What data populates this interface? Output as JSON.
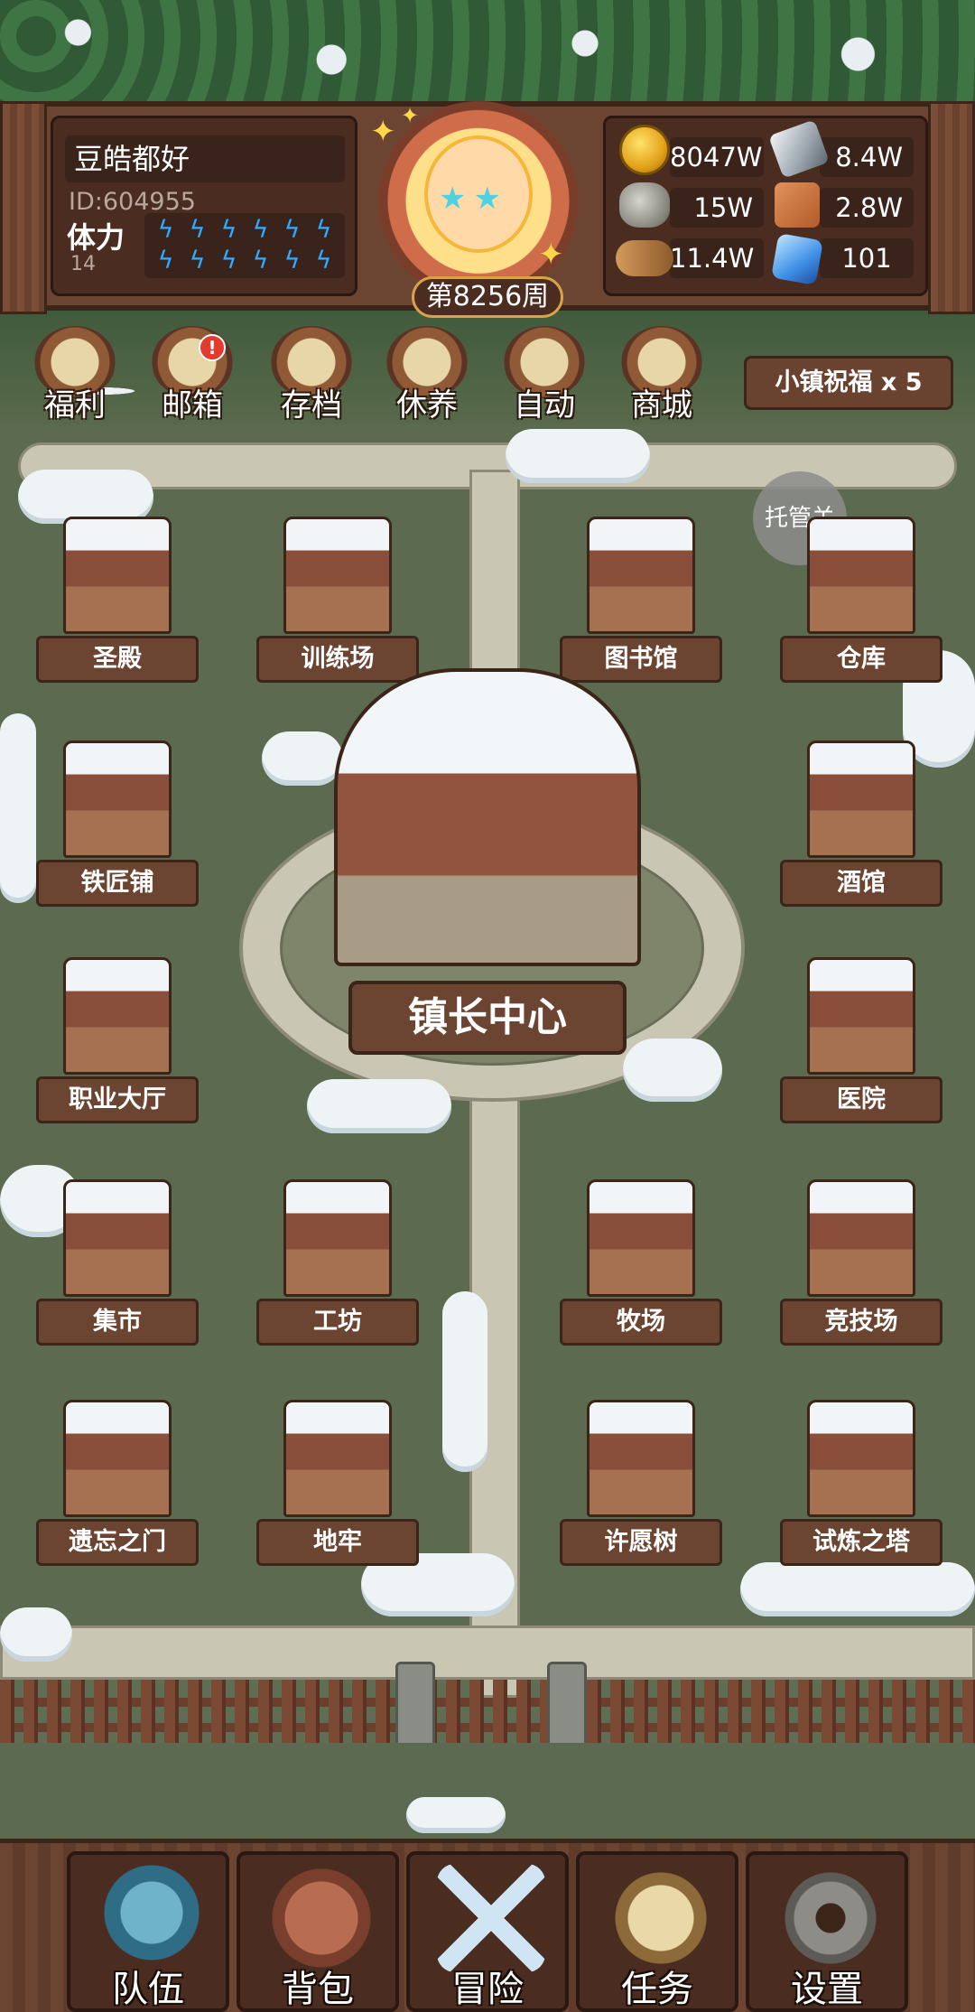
{
  "player": {
    "name": "豆皓都好",
    "id_text": "ID:604955",
    "stamina_label": "体力",
    "stamina_value": "14",
    "week_badge": "第8256周"
  },
  "resources": {
    "gold": "8047W",
    "iron": "8.4W",
    "stone": "15W",
    "leather": "2.8W",
    "wood": "11.4W",
    "crystal": "101"
  },
  "quick_menu": [
    {
      "label": "福利",
      "icon": "wheel-icon"
    },
    {
      "label": "邮箱",
      "icon": "mail-icon",
      "alert": "!"
    },
    {
      "label": "存档",
      "icon": "scroll-icon"
    },
    {
      "label": "休养",
      "icon": "rest-icon"
    },
    {
      "label": "自动",
      "icon": "map-icon"
    },
    {
      "label": "商城",
      "icon": "shop-bag-icon"
    }
  ],
  "blessing": "小镇祝福 x 5",
  "afk_toggle": "托管关",
  "buildings": {
    "temple": "圣殿",
    "training": "训练场",
    "library": "图书馆",
    "warehouse": "仓库",
    "blacksmith": "铁匠铺",
    "tavern": "酒馆",
    "mayor": "镇长中心",
    "guild": "职业大厅",
    "hospital": "医院",
    "market": "集市",
    "workshop": "工坊",
    "ranch": "牧场",
    "arena": "竞技场",
    "portal": "遗忘之门",
    "dungeon": "地牢",
    "wishtree": "许愿树",
    "tower": "试炼之塔"
  },
  "nav": [
    {
      "label": "队伍",
      "icon": "helmet-icon"
    },
    {
      "label": "背包",
      "icon": "backpack-icon"
    },
    {
      "label": "冒险",
      "icon": "crossed-swords-icon"
    },
    {
      "label": "任务",
      "icon": "quest-scroll-icon"
    },
    {
      "label": "设置",
      "icon": "gear-icon"
    }
  ],
  "colors": {
    "wood": "#6b4532",
    "wood_dark": "#3b2418",
    "lawn": "#5c6b4f",
    "stamina_bolt": "#3fa7f2",
    "alert_red": "#e53a2e"
  }
}
